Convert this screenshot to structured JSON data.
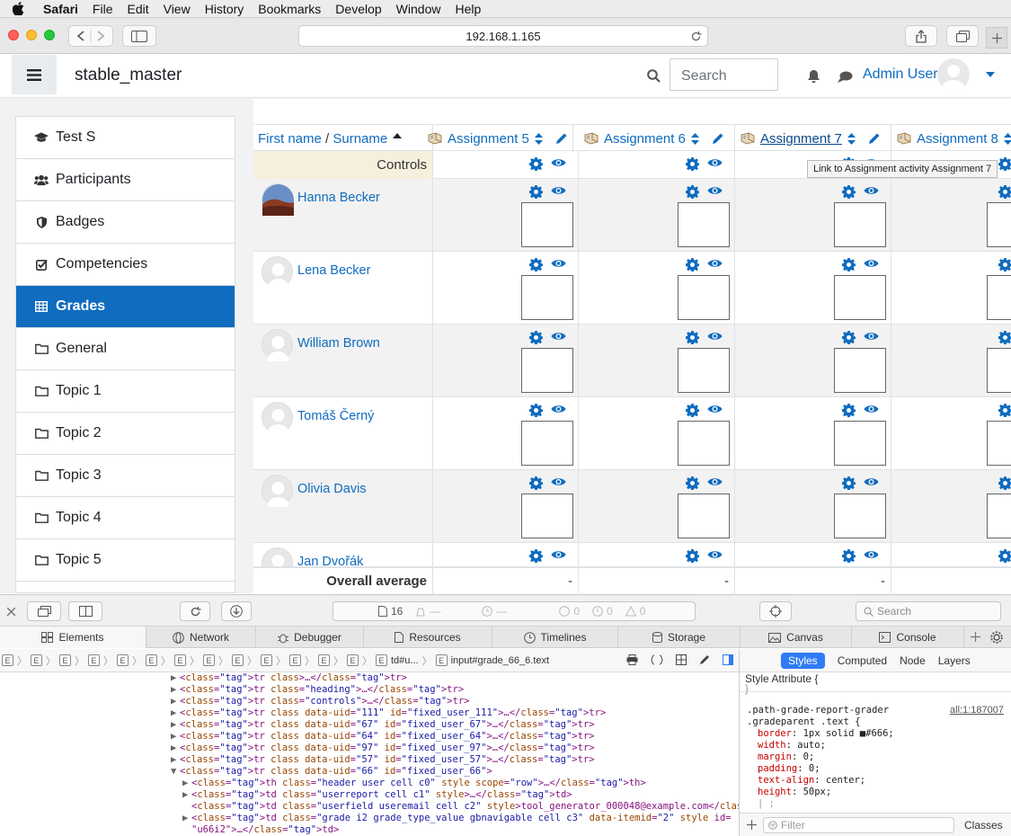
{
  "menubar": {
    "app": "Safari",
    "items": [
      "File",
      "Edit",
      "View",
      "History",
      "Bookmarks",
      "Develop",
      "Window",
      "Help"
    ]
  },
  "browser": {
    "url": "192.168.1.165"
  },
  "site": {
    "name": "stable_master",
    "search_placeholder": "Search",
    "user": "Admin User"
  },
  "sidebar": {
    "items": [
      {
        "label": "Test S",
        "icon": "graduation-cap-icon"
      },
      {
        "label": "Participants",
        "icon": "users-icon"
      },
      {
        "label": "Badges",
        "icon": "shield-icon"
      },
      {
        "label": "Competencies",
        "icon": "checkbox-icon"
      },
      {
        "label": "Grades",
        "icon": "table-icon",
        "active": true
      },
      {
        "label": "General",
        "icon": "folder-icon"
      },
      {
        "label": "Topic 1",
        "icon": "folder-icon"
      },
      {
        "label": "Topic 2",
        "icon": "folder-icon"
      },
      {
        "label": "Topic 3",
        "icon": "folder-icon"
      },
      {
        "label": "Topic 4",
        "icon": "folder-icon"
      },
      {
        "label": "Topic 5",
        "icon": "folder-icon"
      }
    ]
  },
  "grader": {
    "firstname": "First name",
    "slash": " / ",
    "surname": "Surname",
    "assignments": [
      "Assignment 5",
      "Assignment 6",
      "Assignment 7",
      "Assignment 8"
    ],
    "controls_label": "Controls",
    "users": [
      "Hanna Becker",
      "Lena Becker",
      "William Brown",
      "Tomáš Černý",
      "Olivia Davis",
      "Jan Dvořák"
    ],
    "overall_label": "Overall average",
    "overall_values": [
      "-",
      "-",
      "-"
    ],
    "tooltip": "Link to Assignment activity Assignment 7"
  },
  "devtools": {
    "resources_count": "16",
    "counts": [
      "—",
      "—",
      "0",
      "0",
      "0"
    ],
    "search_placeholder": "Search",
    "tabs": [
      "Elements",
      "Network",
      "Debugger",
      "Resources",
      "Timelines",
      "Storage",
      "Canvas",
      "Console"
    ],
    "crumb_tail": [
      "td#u...",
      "input#grade_66_6.text"
    ],
    "dom_lines": [
      {
        "indent": 0,
        "tri": "▶",
        "html": "<tr class>…</tr>"
      },
      {
        "indent": 0,
        "tri": "▶",
        "html": "<tr class=\"heading\">…</tr>"
      },
      {
        "indent": 0,
        "tri": "▶",
        "html": "<tr class=\"controls\">…</tr>"
      },
      {
        "indent": 0,
        "tri": "▶",
        "html": "<tr class data-uid=\"111\" id=\"fixed_user_111\">…</tr>"
      },
      {
        "indent": 0,
        "tri": "▶",
        "html": "<tr class data-uid=\"67\" id=\"fixed_user_67\">…</tr>"
      },
      {
        "indent": 0,
        "tri": "▶",
        "html": "<tr class data-uid=\"64\" id=\"fixed_user_64\">…</tr>"
      },
      {
        "indent": 0,
        "tri": "▶",
        "html": "<tr class data-uid=\"97\" id=\"fixed_user_97\">…</tr>"
      },
      {
        "indent": 0,
        "tri": "▶",
        "html": "<tr class data-uid=\"57\" id=\"fixed_user_57\">…</tr>"
      },
      {
        "indent": 0,
        "tri": "▼",
        "html": "<tr class data-uid=\"66\" id=\"fixed_user_66\">"
      },
      {
        "indent": 1,
        "tri": "▶",
        "html": "<th class=\"header user cell c0\" style scope=\"row\">…</th>"
      },
      {
        "indent": 1,
        "tri": "▶",
        "html": "<td class=\"userreport cell c1\" style>…</td>"
      },
      {
        "indent": 1,
        "tri": "",
        "html": "<td class=\"userfield useremail cell c2\" style>tool_generator_000048@example.com</td>"
      },
      {
        "indent": 1,
        "tri": "▶",
        "html": "<td class=\"grade i2 grade_type_value gbnavigable cell c3\" data-itemid=\"2\" style id="
      },
      {
        "indent": 0,
        "tri": "",
        "html": "\"u66i2\">…</td>"
      }
    ],
    "right_tabs": [
      "Styles",
      "Computed",
      "Node",
      "Layers"
    ],
    "style_attr": "Style Attribute {",
    "style_close": "}",
    "selector1": ".path-grade-report-grader",
    "selector2": ".gradeparent .text {",
    "source": "all:1:187007",
    "props": [
      {
        "name": "border",
        "value": "1px solid ■#666;"
      },
      {
        "name": "width",
        "value": "auto;"
      },
      {
        "name": "margin",
        "value": "0;"
      },
      {
        "name": "padding",
        "value": "0;"
      },
      {
        "name": "text-align",
        "value": "center;"
      },
      {
        "name": "height",
        "value": "50px;"
      }
    ],
    "filter_placeholder": "Filter",
    "classes_label": "Classes"
  }
}
